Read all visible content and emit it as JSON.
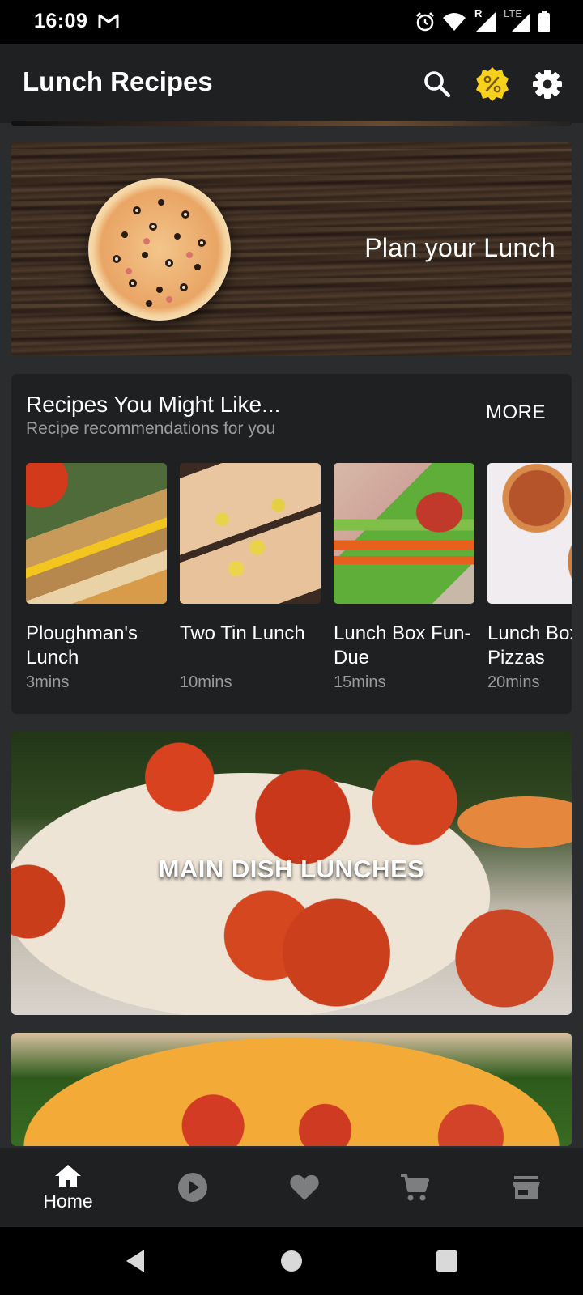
{
  "status_bar": {
    "time": "16:09",
    "network_label": "LTE",
    "roaming_label": "R"
  },
  "app_bar": {
    "title": "Lunch Recipes",
    "icons": [
      "search-icon",
      "discount-badge-icon",
      "settings-icon"
    ],
    "discount_color": "#f6d21f"
  },
  "banner": {
    "text": "Plan your Lunch"
  },
  "recommendations": {
    "title": "Recipes You Might Like...",
    "subtitle": "Recipe recommendations for you",
    "more_label": "MORE",
    "items": [
      {
        "name": "Ploughman's Lunch",
        "time": "3mins"
      },
      {
        "name": "Two Tin Lunch",
        "time": "10mins"
      },
      {
        "name": "Lunch Box Fun-Due",
        "time": "15mins"
      },
      {
        "name": "Lunch Box Pizzas",
        "time": "20mins"
      }
    ]
  },
  "categories": [
    {
      "label": "MAIN DISH LUNCHES"
    }
  ],
  "bottom_nav": {
    "items": [
      {
        "label": "Home",
        "icon": "home-icon",
        "active": true
      },
      {
        "label": "",
        "icon": "play-circle-icon",
        "active": false
      },
      {
        "label": "",
        "icon": "heart-icon",
        "active": false
      },
      {
        "label": "",
        "icon": "cart-icon",
        "active": false
      },
      {
        "label": "",
        "icon": "store-icon",
        "active": false
      }
    ]
  },
  "system_nav": {
    "icons": [
      "back-icon",
      "home-circle-icon",
      "recents-icon"
    ]
  }
}
